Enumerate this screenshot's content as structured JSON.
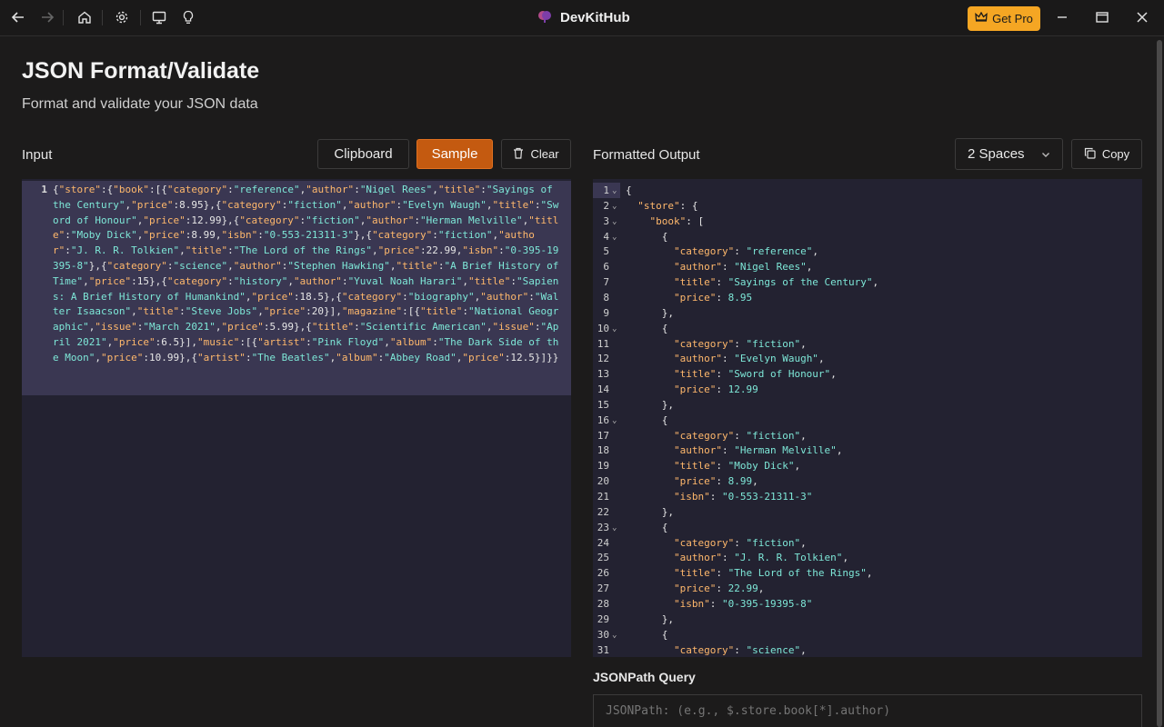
{
  "app": {
    "title": "DevKitHub",
    "get_pro": "Get Pro"
  },
  "icons": {
    "back": "arrow-left-icon",
    "forward": "arrow-right-icon",
    "home": "home-icon",
    "settings": "gear-icon",
    "monitor": "monitor-icon",
    "idea": "lightbulb-icon",
    "logo": "brain-icon",
    "crown": "crown-icon",
    "minimize": "minimize-icon",
    "maximize": "maximize-icon",
    "close": "close-icon",
    "trash": "trash-icon",
    "copy": "copy-icon",
    "chevron": "chevron-down-icon"
  },
  "colors": {
    "accent": "#c45a10",
    "pro": "#f5a623",
    "key": "#ffb86c",
    "string": "#7ee8d8"
  },
  "page": {
    "title": "JSON Format/Validate",
    "subtitle": "Format and validate your JSON data"
  },
  "input": {
    "label": "Input",
    "buttons": {
      "clipboard": "Clipboard",
      "sample": "Sample",
      "clear": "Clear"
    },
    "line_number": "1",
    "content": "{\"store\":{\"book\":[{\"category\":\"reference\",\"author\":\"Nigel Rees\",\"title\":\"Sayings of the Century\",\"price\":8.95},{\"category\":\"fiction\",\"author\":\"Evelyn Waugh\",\"title\":\"Sword of Honour\",\"price\":12.99},{\"category\":\"fiction\",\"author\":\"Herman Melville\",\"title\":\"Moby Dick\",\"price\":8.99,\"isbn\":\"0-553-21311-3\"},{\"category\":\"fiction\",\"author\":\"J. R. R. Tolkien\",\"title\":\"The Lord of the Rings\",\"price\":22.99,\"isbn\":\"0-395-19395-8\"},{\"category\":\"science\",\"author\":\"Stephen Hawking\",\"title\":\"A Brief History of Time\",\"price\":15},{\"category\":\"history\",\"author\":\"Yuval Noah Harari\",\"title\":\"Sapiens: A Brief History of Humankind\",\"price\":18.5},{\"category\":\"biography\",\"author\":\"Walter Isaacson\",\"title\":\"Steve Jobs\",\"price\":20}],\"magazine\":[{\"title\":\"National Geographic\",\"issue\":\"March 2021\",\"price\":5.99},{\"title\":\"Scientific American\",\"issue\":\"April 2021\",\"price\":6.5}],\"music\":[{\"artist\":\"Pink Floyd\",\"album\":\"The Dark Side of the Moon\",\"price\":10.99},{\"artist\":\"The Beatles\",\"album\":\"Abbey Road\",\"price\":12.5}]}}"
  },
  "output": {
    "label": "Formatted Output",
    "indent_option": "2 Spaces",
    "copy": "Copy",
    "lines": [
      {
        "n": "1",
        "indent": 0,
        "fold": true,
        "text": "{"
      },
      {
        "n": "2",
        "indent": 1,
        "fold": true,
        "key": "store",
        "text": "{"
      },
      {
        "n": "3",
        "indent": 2,
        "fold": true,
        "key": "book",
        "text": "["
      },
      {
        "n": "4",
        "indent": 3,
        "fold": true,
        "text": "{"
      },
      {
        "n": "5",
        "indent": 4,
        "key": "category",
        "str": "reference",
        "comma": true
      },
      {
        "n": "6",
        "indent": 4,
        "key": "author",
        "str": "Nigel Rees",
        "comma": true
      },
      {
        "n": "7",
        "indent": 4,
        "key": "title",
        "str": "Sayings of the Century",
        "comma": true
      },
      {
        "n": "8",
        "indent": 4,
        "key": "price",
        "num": "8.95"
      },
      {
        "n": "9",
        "indent": 3,
        "text": "},"
      },
      {
        "n": "10",
        "indent": 3,
        "fold": true,
        "text": "{"
      },
      {
        "n": "11",
        "indent": 4,
        "key": "category",
        "str": "fiction",
        "comma": true
      },
      {
        "n": "12",
        "indent": 4,
        "key": "author",
        "str": "Evelyn Waugh",
        "comma": true
      },
      {
        "n": "13",
        "indent": 4,
        "key": "title",
        "str": "Sword of Honour",
        "comma": true
      },
      {
        "n": "14",
        "indent": 4,
        "key": "price",
        "num": "12.99"
      },
      {
        "n": "15",
        "indent": 3,
        "text": "},"
      },
      {
        "n": "16",
        "indent": 3,
        "fold": true,
        "text": "{"
      },
      {
        "n": "17",
        "indent": 4,
        "key": "category",
        "str": "fiction",
        "comma": true
      },
      {
        "n": "18",
        "indent": 4,
        "key": "author",
        "str": "Herman Melville",
        "comma": true
      },
      {
        "n": "19",
        "indent": 4,
        "key": "title",
        "str": "Moby Dick",
        "comma": true
      },
      {
        "n": "20",
        "indent": 4,
        "key": "price",
        "num": "8.99",
        "comma": true
      },
      {
        "n": "21",
        "indent": 4,
        "key": "isbn",
        "str": "0-553-21311-3"
      },
      {
        "n": "22",
        "indent": 3,
        "text": "},"
      },
      {
        "n": "23",
        "indent": 3,
        "fold": true,
        "text": "{"
      },
      {
        "n": "24",
        "indent": 4,
        "key": "category",
        "str": "fiction",
        "comma": true
      },
      {
        "n": "25",
        "indent": 4,
        "key": "author",
        "str": "J. R. R. Tolkien",
        "comma": true
      },
      {
        "n": "26",
        "indent": 4,
        "key": "title",
        "str": "The Lord of the Rings",
        "comma": true
      },
      {
        "n": "27",
        "indent": 4,
        "key": "price",
        "num": "22.99",
        "comma": true
      },
      {
        "n": "28",
        "indent": 4,
        "key": "isbn",
        "str": "0-395-19395-8"
      },
      {
        "n": "29",
        "indent": 3,
        "text": "},"
      },
      {
        "n": "30",
        "indent": 3,
        "fold": true,
        "text": "{"
      },
      {
        "n": "31",
        "indent": 4,
        "key": "category",
        "str": "science",
        "comma": true
      }
    ]
  },
  "jsonpath": {
    "label": "JSONPath Query",
    "placeholder": "JSONPath: (e.g., $.store.book[*].author)"
  }
}
